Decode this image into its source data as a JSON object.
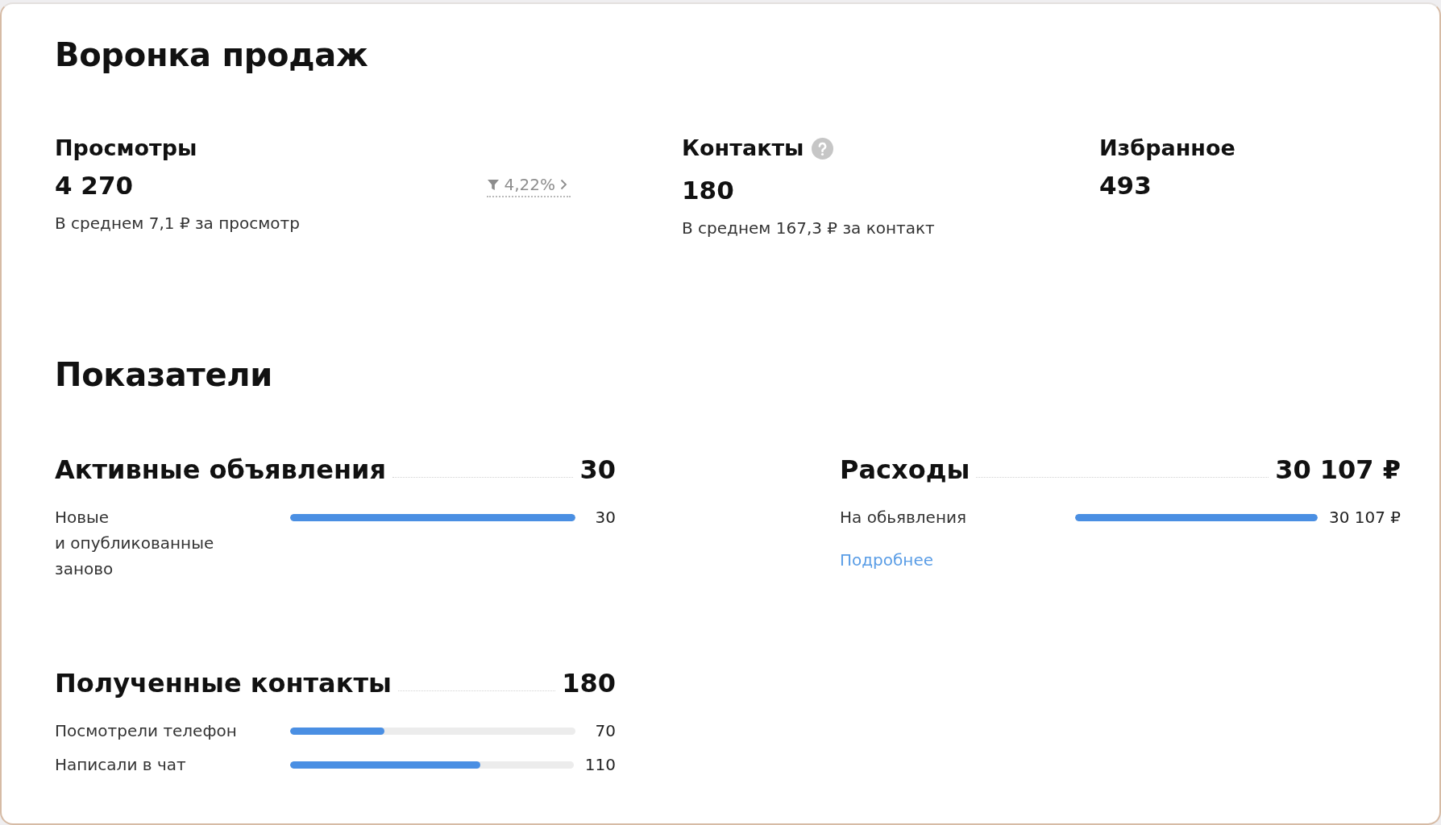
{
  "sales_funnel": {
    "title": "Воронка продаж",
    "stats": [
      {
        "label": "Просмотры",
        "help": false,
        "value": "4 270",
        "trend": "4,22%",
        "note": "В среднем 7,1 ₽ за просмотр"
      },
      {
        "label": "Контакты",
        "help": true,
        "value": "180",
        "note": "В среднем 167,3 ₽ за контакт"
      },
      {
        "label": "Избранное",
        "help": false,
        "value": "493"
      }
    ]
  },
  "indicators": {
    "title": "Показатели",
    "groups": [
      {
        "title": "Активные объявления",
        "total": "30",
        "rows": [
          {
            "label": "Новые и опубликованные заново",
            "level": 1.0,
            "value": "30"
          }
        ]
      },
      {
        "title": "Расходы",
        "total": "30 107 ₽",
        "rows": [
          {
            "label": "На обьявления",
            "level": 1.0,
            "value": "30 107 ₽"
          }
        ],
        "link": "Подробнее"
      },
      {
        "title": "Полученные контакты",
        "total": "180",
        "rows": [
          {
            "label": "Посмотрели телефон",
            "level": 0.33,
            "value": "70"
          },
          {
            "label": "Написали в чат",
            "level": 0.67,
            "value": "110"
          }
        ]
      }
    ]
  }
}
